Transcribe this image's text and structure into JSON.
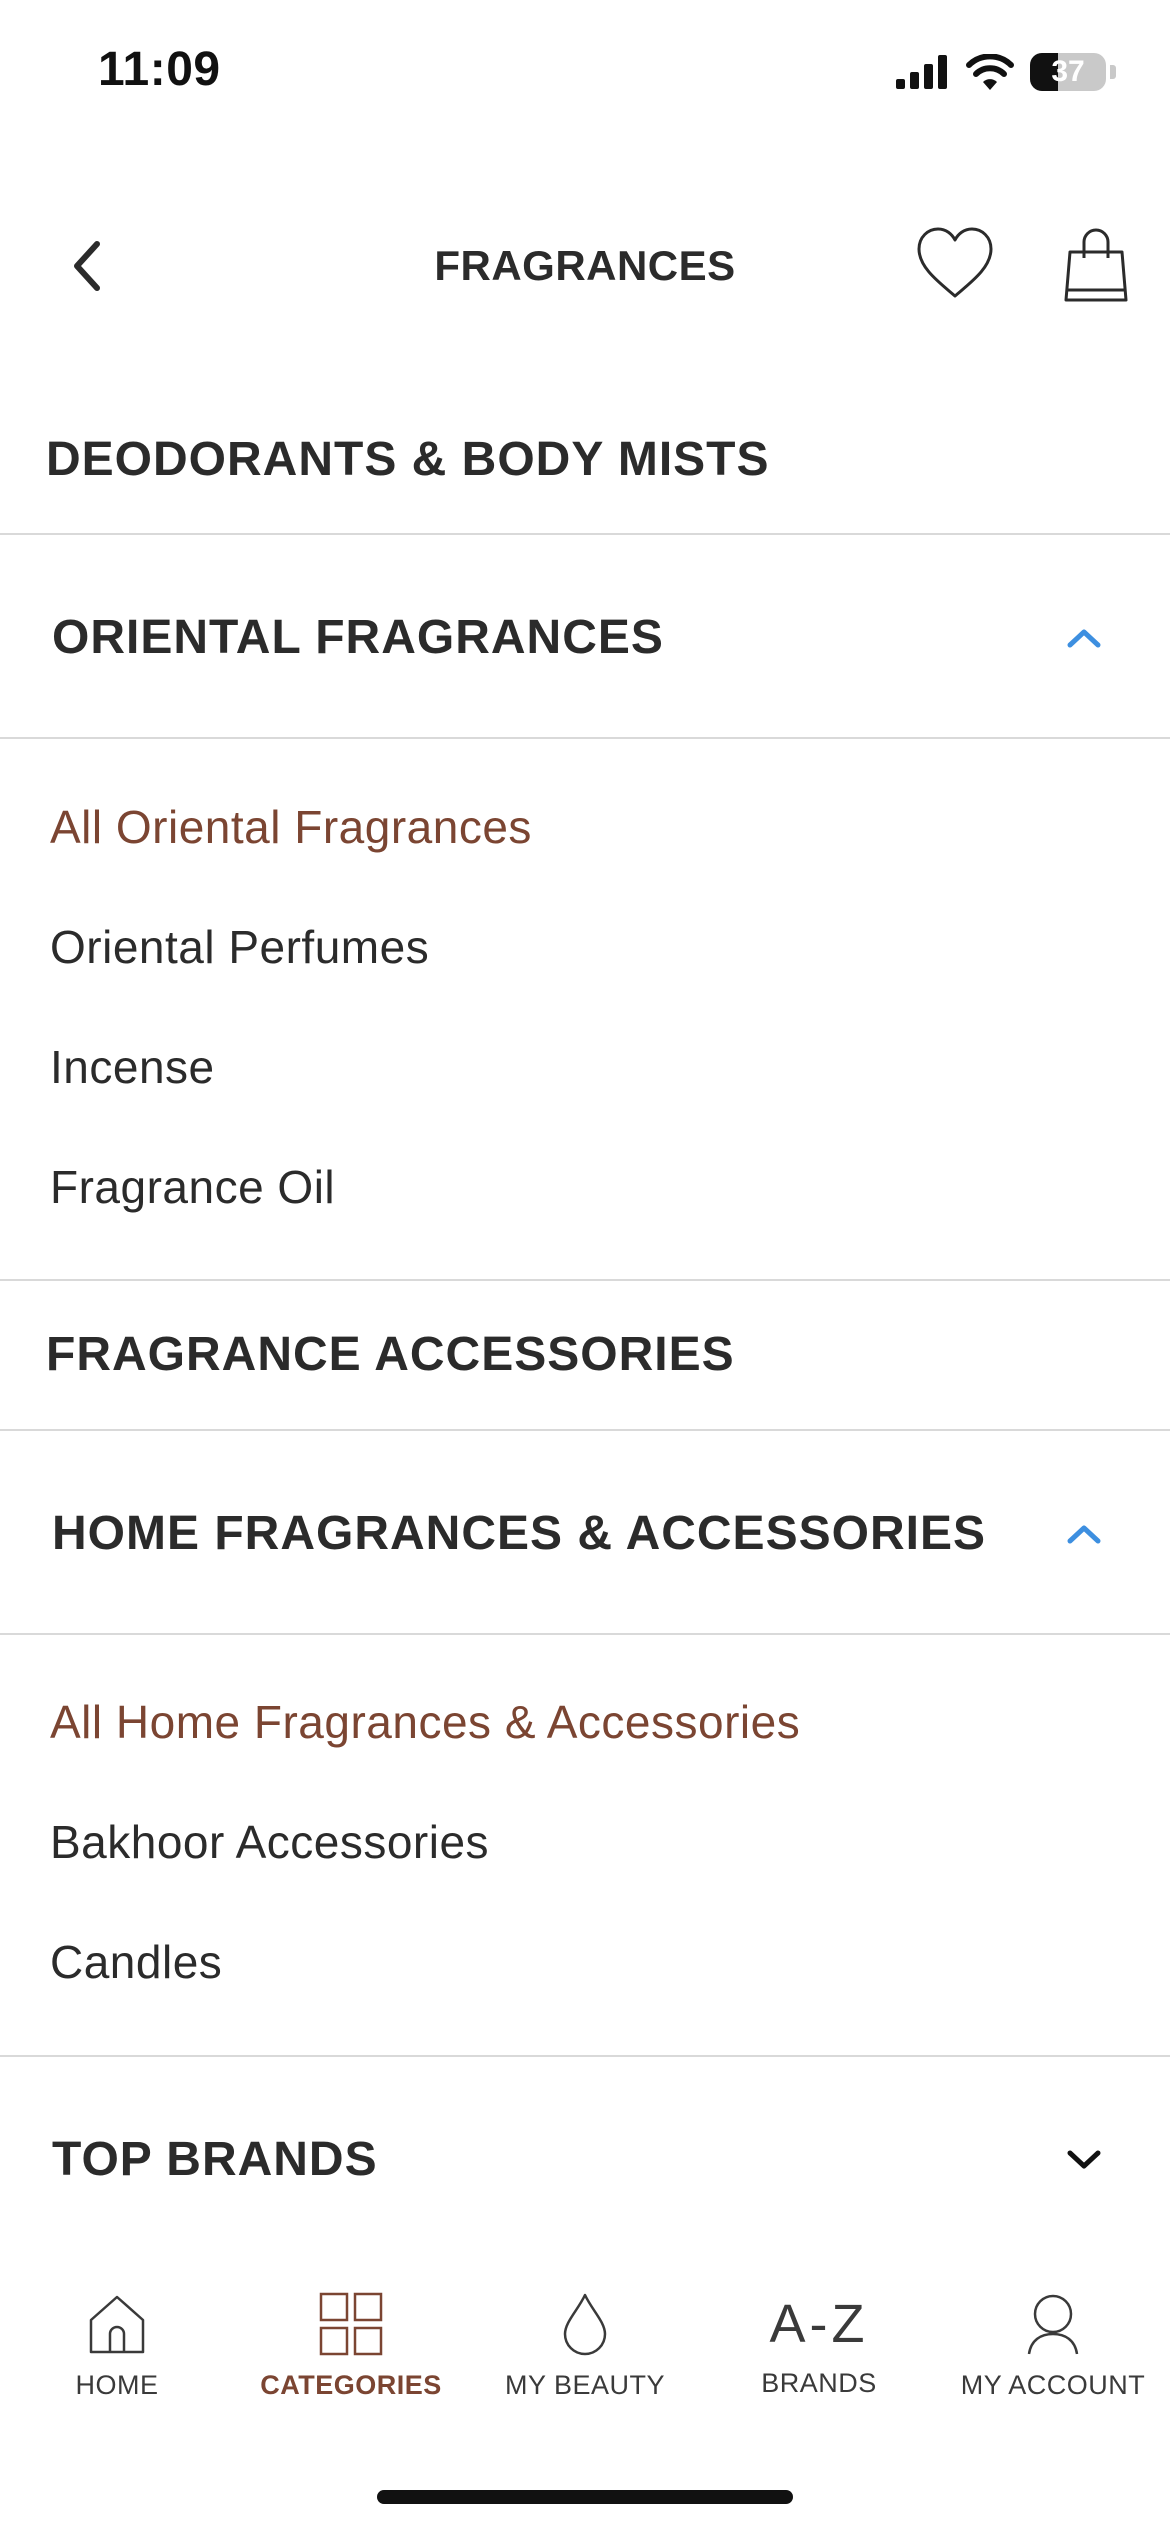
{
  "status_bar": {
    "time": "11:09",
    "battery": "37",
    "battery_level": 0.37
  },
  "header": {
    "title": "FRAGRANCES"
  },
  "sections": [
    {
      "title": "DEODORANTS & BODY MISTS"
    },
    {
      "title": "ORIENTAL FRAGRANCES",
      "items": [
        "All Oriental Fragrances",
        "Oriental Perfumes",
        "Incense",
        "Fragrance Oil"
      ]
    },
    {
      "title": "FRAGRANCE ACCESSORIES"
    },
    {
      "title": "HOME FRAGRANCES & ACCESSORIES",
      "items": [
        "All Home Fragrances & Accessories",
        "Bakhoor Accessories",
        "Candles"
      ]
    },
    {
      "title": "TOP BRANDS"
    }
  ],
  "tab_bar": {
    "active": "CATEGORIES",
    "tabs": [
      {
        "label": "HOME",
        "icon": "home-icon"
      },
      {
        "label": "CATEGORIES",
        "icon": "categories-grid-icon"
      },
      {
        "label": "MY BEAUTY",
        "icon": "droplet-icon"
      },
      {
        "label": "BRANDS",
        "icon": "a-z-icon",
        "icon_text": "A-Z"
      },
      {
        "label": "MY ACCOUNT",
        "icon": "user-icon"
      }
    ]
  },
  "colors": {
    "accent": "#7b4532",
    "chevron_blue": "#3d8fe0",
    "text": "#2b2b2b",
    "divider": "#d9d9d9"
  }
}
